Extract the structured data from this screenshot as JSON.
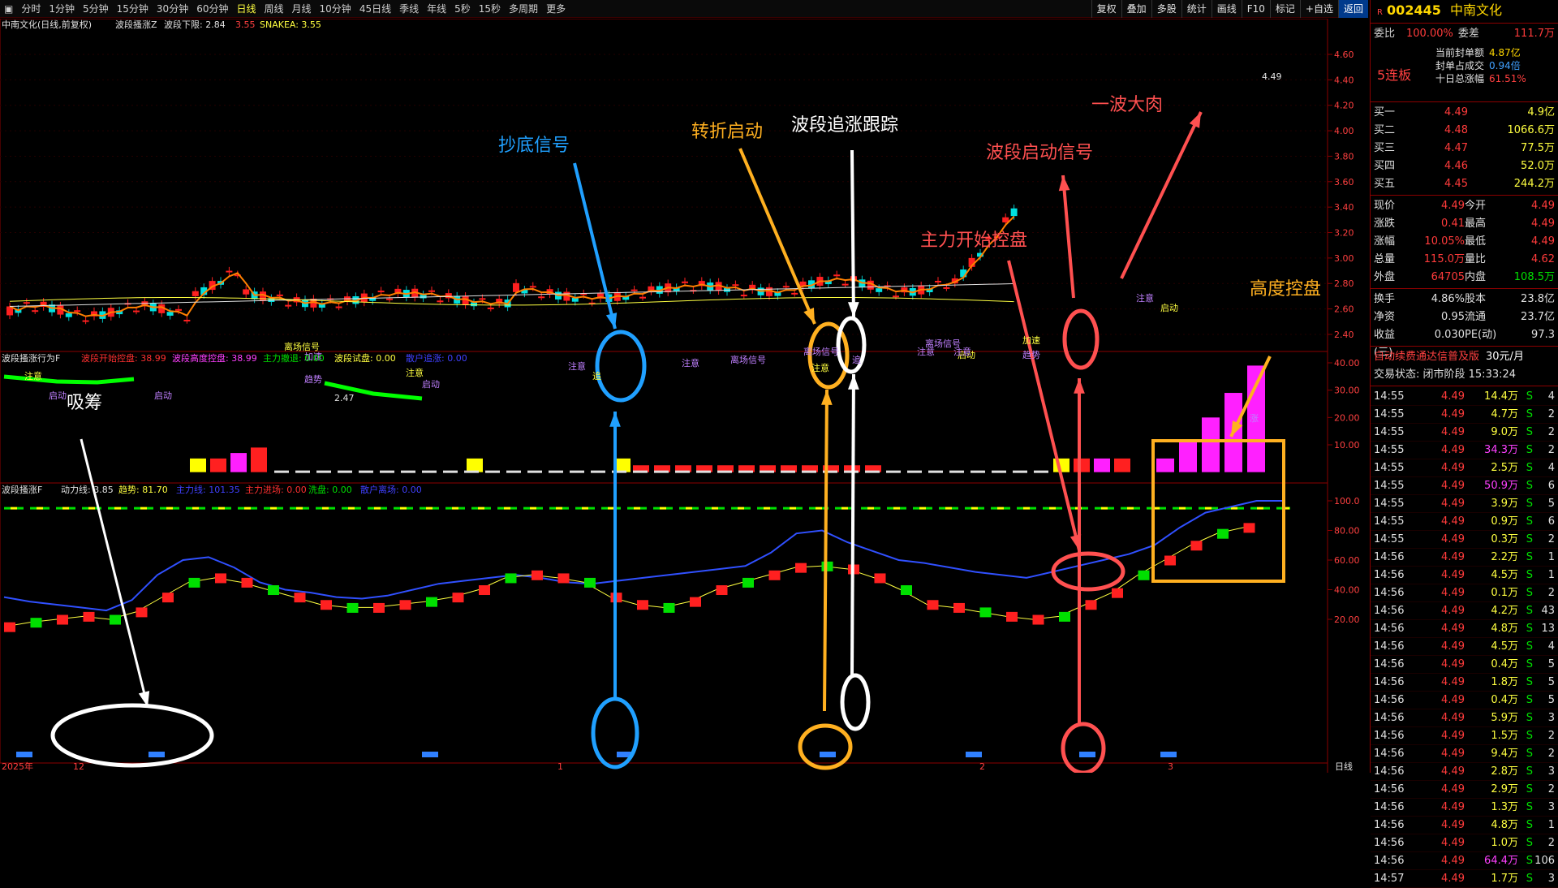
{
  "toolbar": {
    "items": [
      "分时",
      "1分钟",
      "5分钟",
      "15分钟",
      "30分钟",
      "60分钟",
      "日线",
      "周线",
      "月线",
      "10分钟",
      "45日线",
      "季线",
      "年线",
      "5秒",
      "15秒",
      "多周期",
      "更多"
    ],
    "active_index": 6,
    "right_buttons": [
      "复权",
      "叠加",
      "多股",
      "统计",
      "画线",
      "F10",
      "标记",
      "+自选",
      "返回"
    ]
  },
  "panel1": {
    "title": "中南文化(日线,前复权)",
    "indicator": "波段搔涨Z",
    "line1_label": "波段下限: 2.84",
    "line1_extra": "3.55",
    "line2_label": "SNAKEA: 3.55",
    "y_ticks": [
      "4.60",
      "4.40",
      "4.20",
      "4.00",
      "3.80",
      "3.60",
      "3.40",
      "3.20",
      "3.00",
      "2.80",
      "2.60",
      "2.40"
    ],
    "price_high_label": "4.49",
    "price_low_label": "2.47",
    "chart_labels": [
      "注意",
      "启动",
      "启动",
      "离场信号",
      "加速",
      "趋势",
      "注意",
      "启动",
      "注意",
      "追",
      "注意",
      "离场信号",
      "注意",
      "离场信号",
      "注意",
      "启动",
      "离场信号",
      "注意",
      "加速",
      "趋势",
      "注意",
      "启动",
      "追",
      "涨"
    ]
  },
  "panel2": {
    "title": "波段搔涨行为F",
    "items": [
      {
        "label": "波段开始控盘: 38.99",
        "color": "#ff3030"
      },
      {
        "label": "波段高度控盘: 38.99",
        "color": "#ff40ff"
      },
      {
        "label": "主力撤退: 0.00",
        "color": "#00e000"
      },
      {
        "label": "波段试盘: 0.00",
        "color": "#ffff40"
      },
      {
        "label": "散户追涨: 0.00",
        "color": "#4040ff"
      }
    ],
    "y_ticks": [
      "40.00",
      "30.00",
      "20.00",
      "10.00"
    ]
  },
  "panel3": {
    "title": "波段搔涨F",
    "items": [
      {
        "label": "动力线: 3.85",
        "color": "#e0e0e0"
      },
      {
        "label": "趋势: 81.70",
        "color": "#ffff40"
      },
      {
        "label": "主力线: 101.35",
        "color": "#4040ff"
      },
      {
        "label": "主力进场: 0.00",
        "color": "#ff3030"
      },
      {
        "label": "洗盘: 0.00",
        "color": "#00e000"
      },
      {
        "label": "散户离场: 0.00",
        "color": "#4040ff"
      }
    ],
    "y_ticks": [
      "100.0",
      "80.00",
      "60.00",
      "40.00",
      "20.00"
    ],
    "x_ticks": [
      "2025年",
      "12",
      "1",
      "2",
      "3"
    ],
    "period_label": "日线"
  },
  "annotations": {
    "xichou": "吸筹",
    "chaodi": "抄底信号",
    "zhuanzhe": "转折启动",
    "zhuizhang": "波段追涨跟踪",
    "zhuli": "主力开始控盘",
    "qidong": "波段启动信号",
    "darou": "一波大肉",
    "gaodu": "高度控盘"
  },
  "sidebar": {
    "code": "002445",
    "name": "中南文化",
    "weibi_label": "委比",
    "weibi_value": "100.00%",
    "weicha_label": "委差",
    "weicha_value": "111.7万",
    "seal_rows": [
      {
        "label": "当前封单额",
        "value": "4.87亿"
      },
      {
        "label": "封单占成交",
        "value": "0.94倍"
      },
      {
        "label": "十日总涨幅",
        "value": "61.51%"
      }
    ],
    "lianban": "5连板",
    "bids": [
      {
        "label": "买一",
        "price": "4.49",
        "vol": "4.9亿"
      },
      {
        "label": "买二",
        "price": "4.48",
        "vol": "1066.6万"
      },
      {
        "label": "买三",
        "price": "4.47",
        "vol": "77.5万"
      },
      {
        "label": "买四",
        "price": "4.46",
        "vol": "52.0万"
      },
      {
        "label": "买五",
        "price": "4.45",
        "vol": "244.2万"
      }
    ],
    "info": [
      {
        "l1": "现价",
        "v1": "4.49",
        "l2": "今开",
        "v2": "4.49"
      },
      {
        "l1": "涨跌",
        "v1": "0.41",
        "l2": "最高",
        "v2": "4.49"
      },
      {
        "l1": "涨幅",
        "v1": "10.05%",
        "l2": "最低",
        "v2": "4.49"
      },
      {
        "l1": "总量",
        "v1": "115.0万",
        "l2": "量比",
        "v2": "4.62"
      },
      {
        "l1": "外盘",
        "v1": "64705",
        "l2": "内盘",
        "v2": "108.5万"
      }
    ],
    "info2": [
      {
        "l1": "换手",
        "v1": "4.86%",
        "l2": "股本",
        "v2": "23.8亿"
      },
      {
        "l1": "净资",
        "v1": "0.95",
        "l2": "流通",
        "v2": "23.7亿"
      },
      {
        "l1": "收益(三)",
        "v1": "0.030",
        "l2": "PE(动)",
        "v2": "97.3"
      }
    ],
    "promo": "自动续费通达信普及版",
    "promo_price": "30元/月",
    "trade_status": "交易状态: 闭市阶段 15:33:24",
    "ticks": [
      [
        "14:55",
        "4.49",
        "14.4万",
        "S",
        "4"
      ],
      [
        "14:55",
        "4.49",
        "4.7万",
        "S",
        "2"
      ],
      [
        "14:55",
        "4.49",
        "9.0万",
        "S",
        "2"
      ],
      [
        "14:55",
        "4.49",
        "34.3万",
        "S",
        "2"
      ],
      [
        "14:55",
        "4.49",
        "2.5万",
        "S",
        "4"
      ],
      [
        "14:55",
        "4.49",
        "50.9万",
        "S",
        "6"
      ],
      [
        "14:55",
        "4.49",
        "3.9万",
        "S",
        "5"
      ],
      [
        "14:55",
        "4.49",
        "0.9万",
        "S",
        "6"
      ],
      [
        "14:55",
        "4.49",
        "0.3万",
        "S",
        "2"
      ],
      [
        "14:56",
        "4.49",
        "2.2万",
        "S",
        "1"
      ],
      [
        "14:56",
        "4.49",
        "4.5万",
        "S",
        "1"
      ],
      [
        "14:56",
        "4.49",
        "0.1万",
        "S",
        "2"
      ],
      [
        "14:56",
        "4.49",
        "4.2万",
        "S",
        "43"
      ],
      [
        "14:56",
        "4.49",
        "4.8万",
        "S",
        "13"
      ],
      [
        "14:56",
        "4.49",
        "4.5万",
        "S",
        "4"
      ],
      [
        "14:56",
        "4.49",
        "0.4万",
        "S",
        "5"
      ],
      [
        "14:56",
        "4.49",
        "1.8万",
        "S",
        "5"
      ],
      [
        "14:56",
        "4.49",
        "0.4万",
        "S",
        "5"
      ],
      [
        "14:56",
        "4.49",
        "5.9万",
        "S",
        "3"
      ],
      [
        "14:56",
        "4.49",
        "1.5万",
        "S",
        "2"
      ],
      [
        "14:56",
        "4.49",
        "9.4万",
        "S",
        "2"
      ],
      [
        "14:56",
        "4.49",
        "2.8万",
        "S",
        "3"
      ],
      [
        "14:56",
        "4.49",
        "2.9万",
        "S",
        "2"
      ],
      [
        "14:56",
        "4.49",
        "1.3万",
        "S",
        "3"
      ],
      [
        "14:56",
        "4.49",
        "4.8万",
        "S",
        "1"
      ],
      [
        "14:56",
        "4.49",
        "1.0万",
        "S",
        "2"
      ],
      [
        "14:56",
        "4.49",
        "64.4万",
        "S",
        "106"
      ],
      [
        "14:57",
        "4.49",
        "1.7万",
        "S",
        "3"
      ]
    ]
  }
}
